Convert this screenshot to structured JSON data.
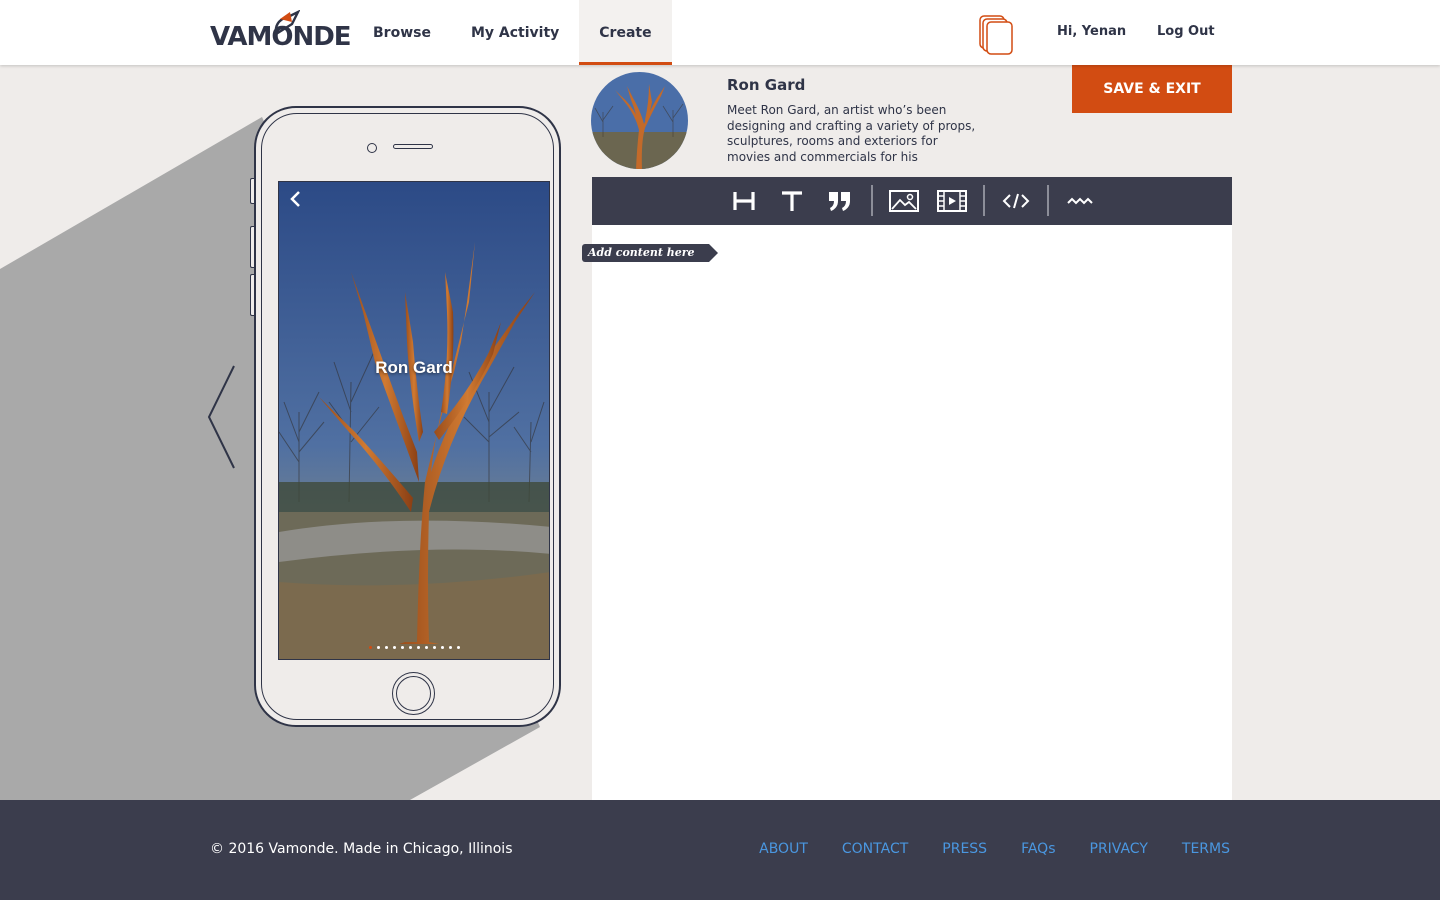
{
  "brand": {
    "logo_text": "VAMONDE",
    "accent": "#d24c12",
    "dark": "#2f3447",
    "toolbar_bg": "#3b3d4d"
  },
  "nav": {
    "items": [
      {
        "label": "Browse"
      },
      {
        "label": "My Activity"
      },
      {
        "label": "Create"
      }
    ],
    "active": "Create"
  },
  "header": {
    "greeting": "Hi, Yenan",
    "logout": "Log Out",
    "cards_icon": "stacked-cards-icon"
  },
  "preview": {
    "back_icon": "chevron-left-icon",
    "title": "Ron Gard",
    "page_count": 12,
    "active_page": 1,
    "prev_icon": "chevron-left-icon"
  },
  "story": {
    "title": "Ron Gard",
    "description": "Meet Ron Gard, an artist who’s been designing and crafting a variety of props, sculptures, rooms and exteriors for movies and commercials for his",
    "save_exit": "SAVE & EXIT"
  },
  "toolbar": {
    "tools": [
      {
        "icon": "heading-icon"
      },
      {
        "icon": "text-icon"
      },
      {
        "icon": "quote-icon"
      },
      {
        "icon": "image-icon"
      },
      {
        "icon": "video-icon"
      },
      {
        "icon": "embed-code-icon"
      },
      {
        "icon": "divider-wave-icon"
      }
    ]
  },
  "editor": {
    "add_content": "Add content here"
  },
  "footer": {
    "copyright": "© 2016 Vamonde. Made in Chicago, Illinois",
    "links": [
      "ABOUT",
      "CONTACT",
      "PRESS",
      "FAQs",
      "PRIVACY",
      "TERMS"
    ]
  }
}
